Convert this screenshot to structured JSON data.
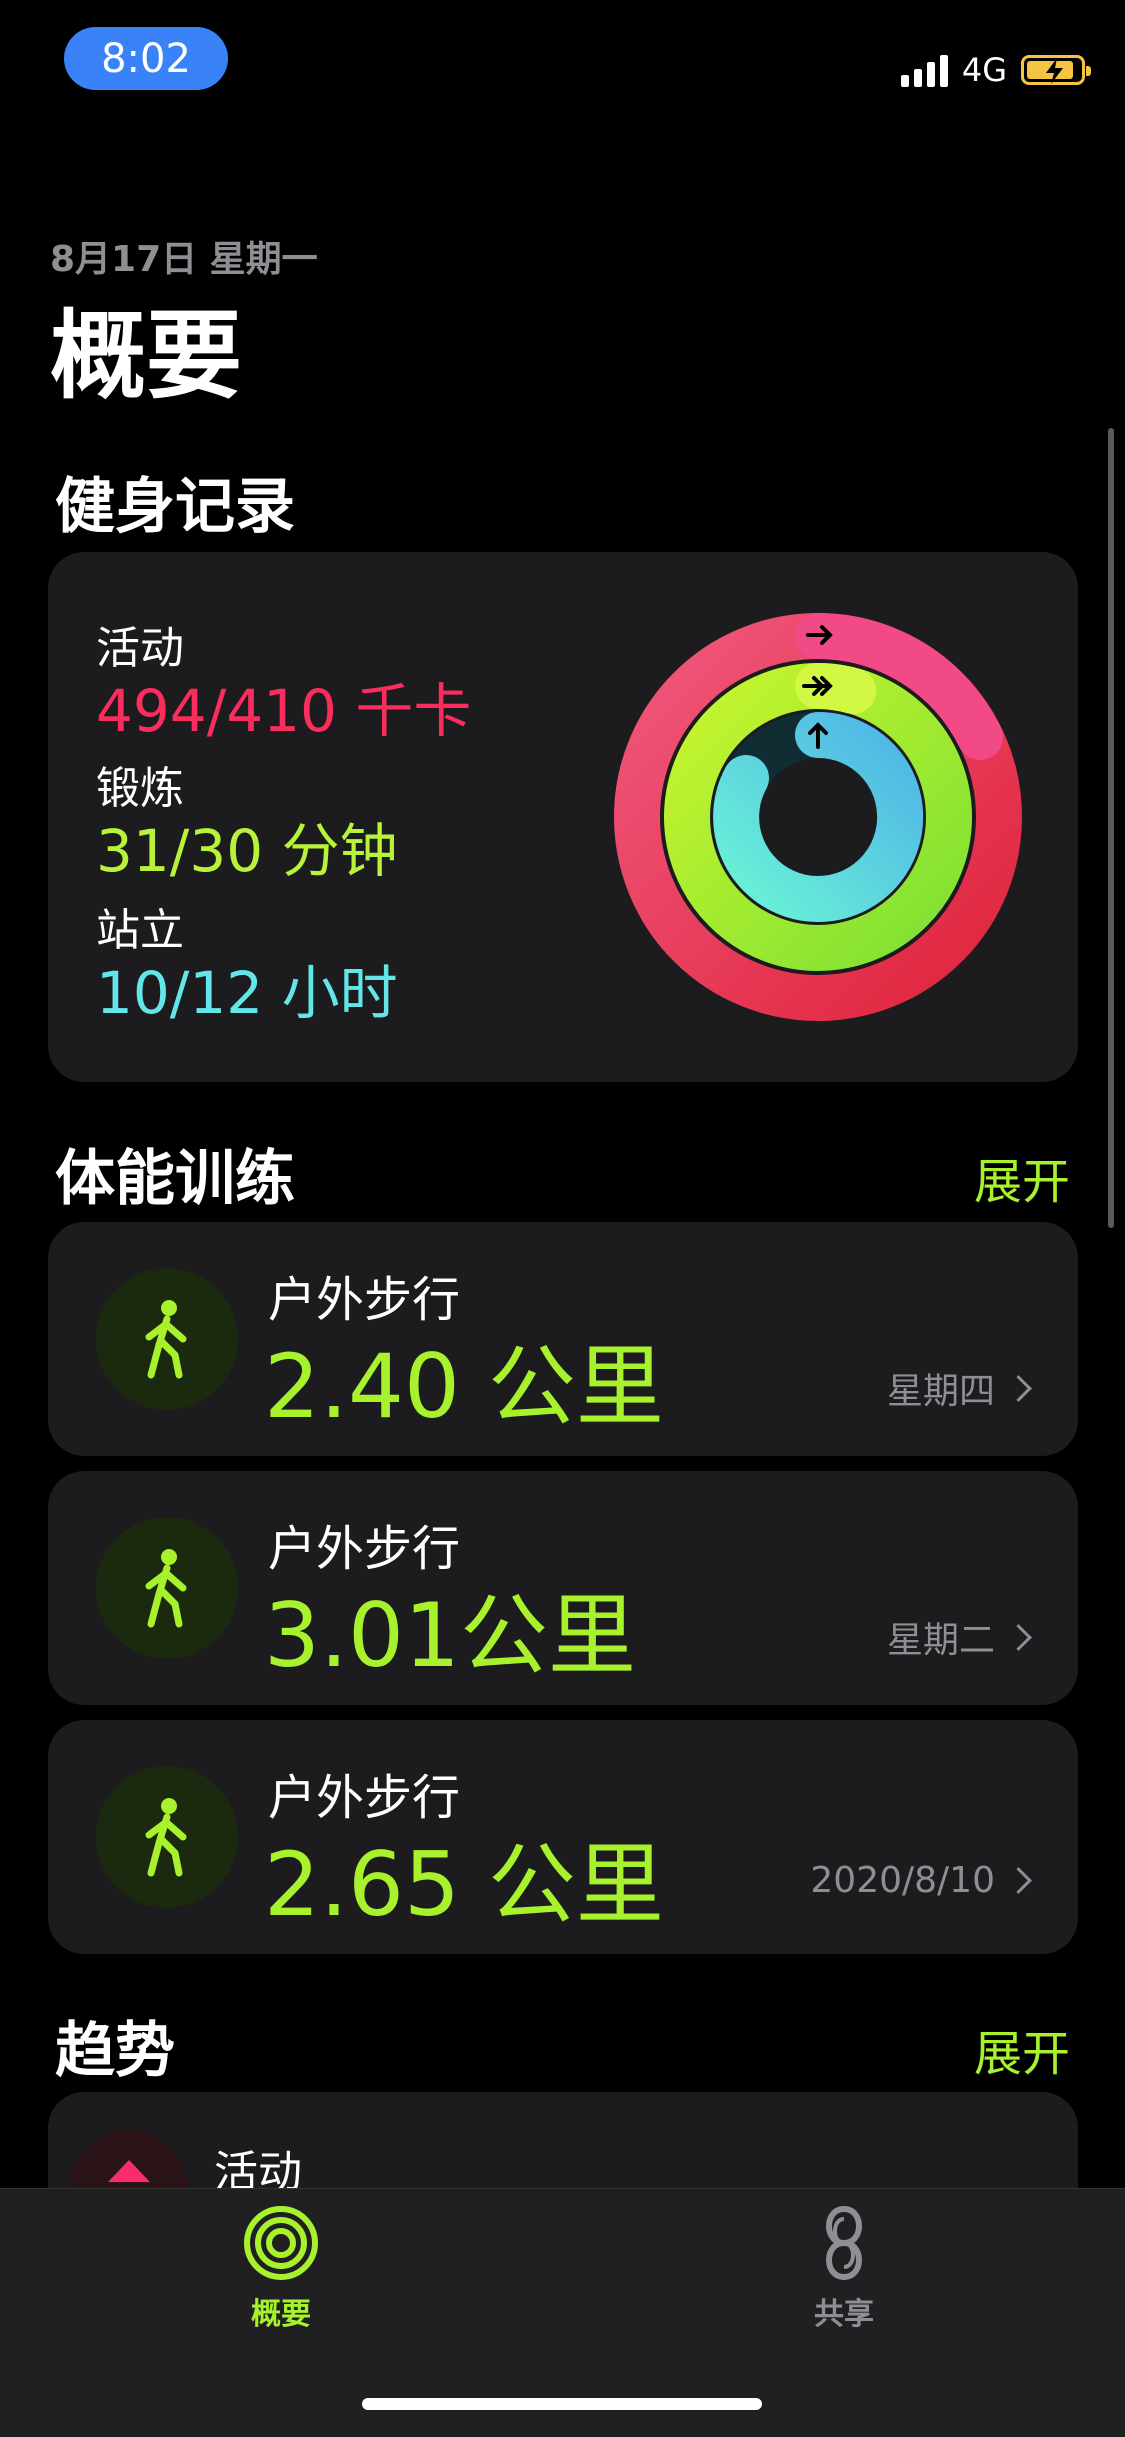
{
  "status_bar": {
    "time": "8:02",
    "network": "4G"
  },
  "header": {
    "date": "8月17日 星期一",
    "title": "概要"
  },
  "fitness_record": {
    "section_title": "健身记录",
    "move": {
      "label": "活动",
      "value": "494/410 千卡",
      "color": "#fa114f",
      "progress": 1.2
    },
    "exercise": {
      "label": "锻炼",
      "value": "31/30 分钟",
      "color": "#a7f12d",
      "progress": 1.03
    },
    "stand": {
      "label": "站立",
      "value": "10/12 小时",
      "color": "#5fe3e8",
      "progress": 0.83
    }
  },
  "workouts": {
    "section_title": "体能训练",
    "expand_label": "展开",
    "items": [
      {
        "type": "户外步行",
        "distance": "2.40 公里",
        "date": "星期四"
      },
      {
        "type": "户外步行",
        "distance": "3.01公里",
        "date": "星期二"
      },
      {
        "type": "户外步行",
        "distance": "2.65 公里",
        "date": "2020/8/10"
      }
    ]
  },
  "trends": {
    "section_title": "趋势",
    "expand_label": "展开",
    "first_item_label": "活动"
  },
  "tabbar": {
    "items": [
      {
        "label": "概要",
        "icon": "activity-rings-icon",
        "active": true,
        "color": "#a7f12d"
      },
      {
        "label": "共享",
        "icon": "sharing-icon",
        "active": false,
        "color": "#8e8e93"
      }
    ]
  }
}
